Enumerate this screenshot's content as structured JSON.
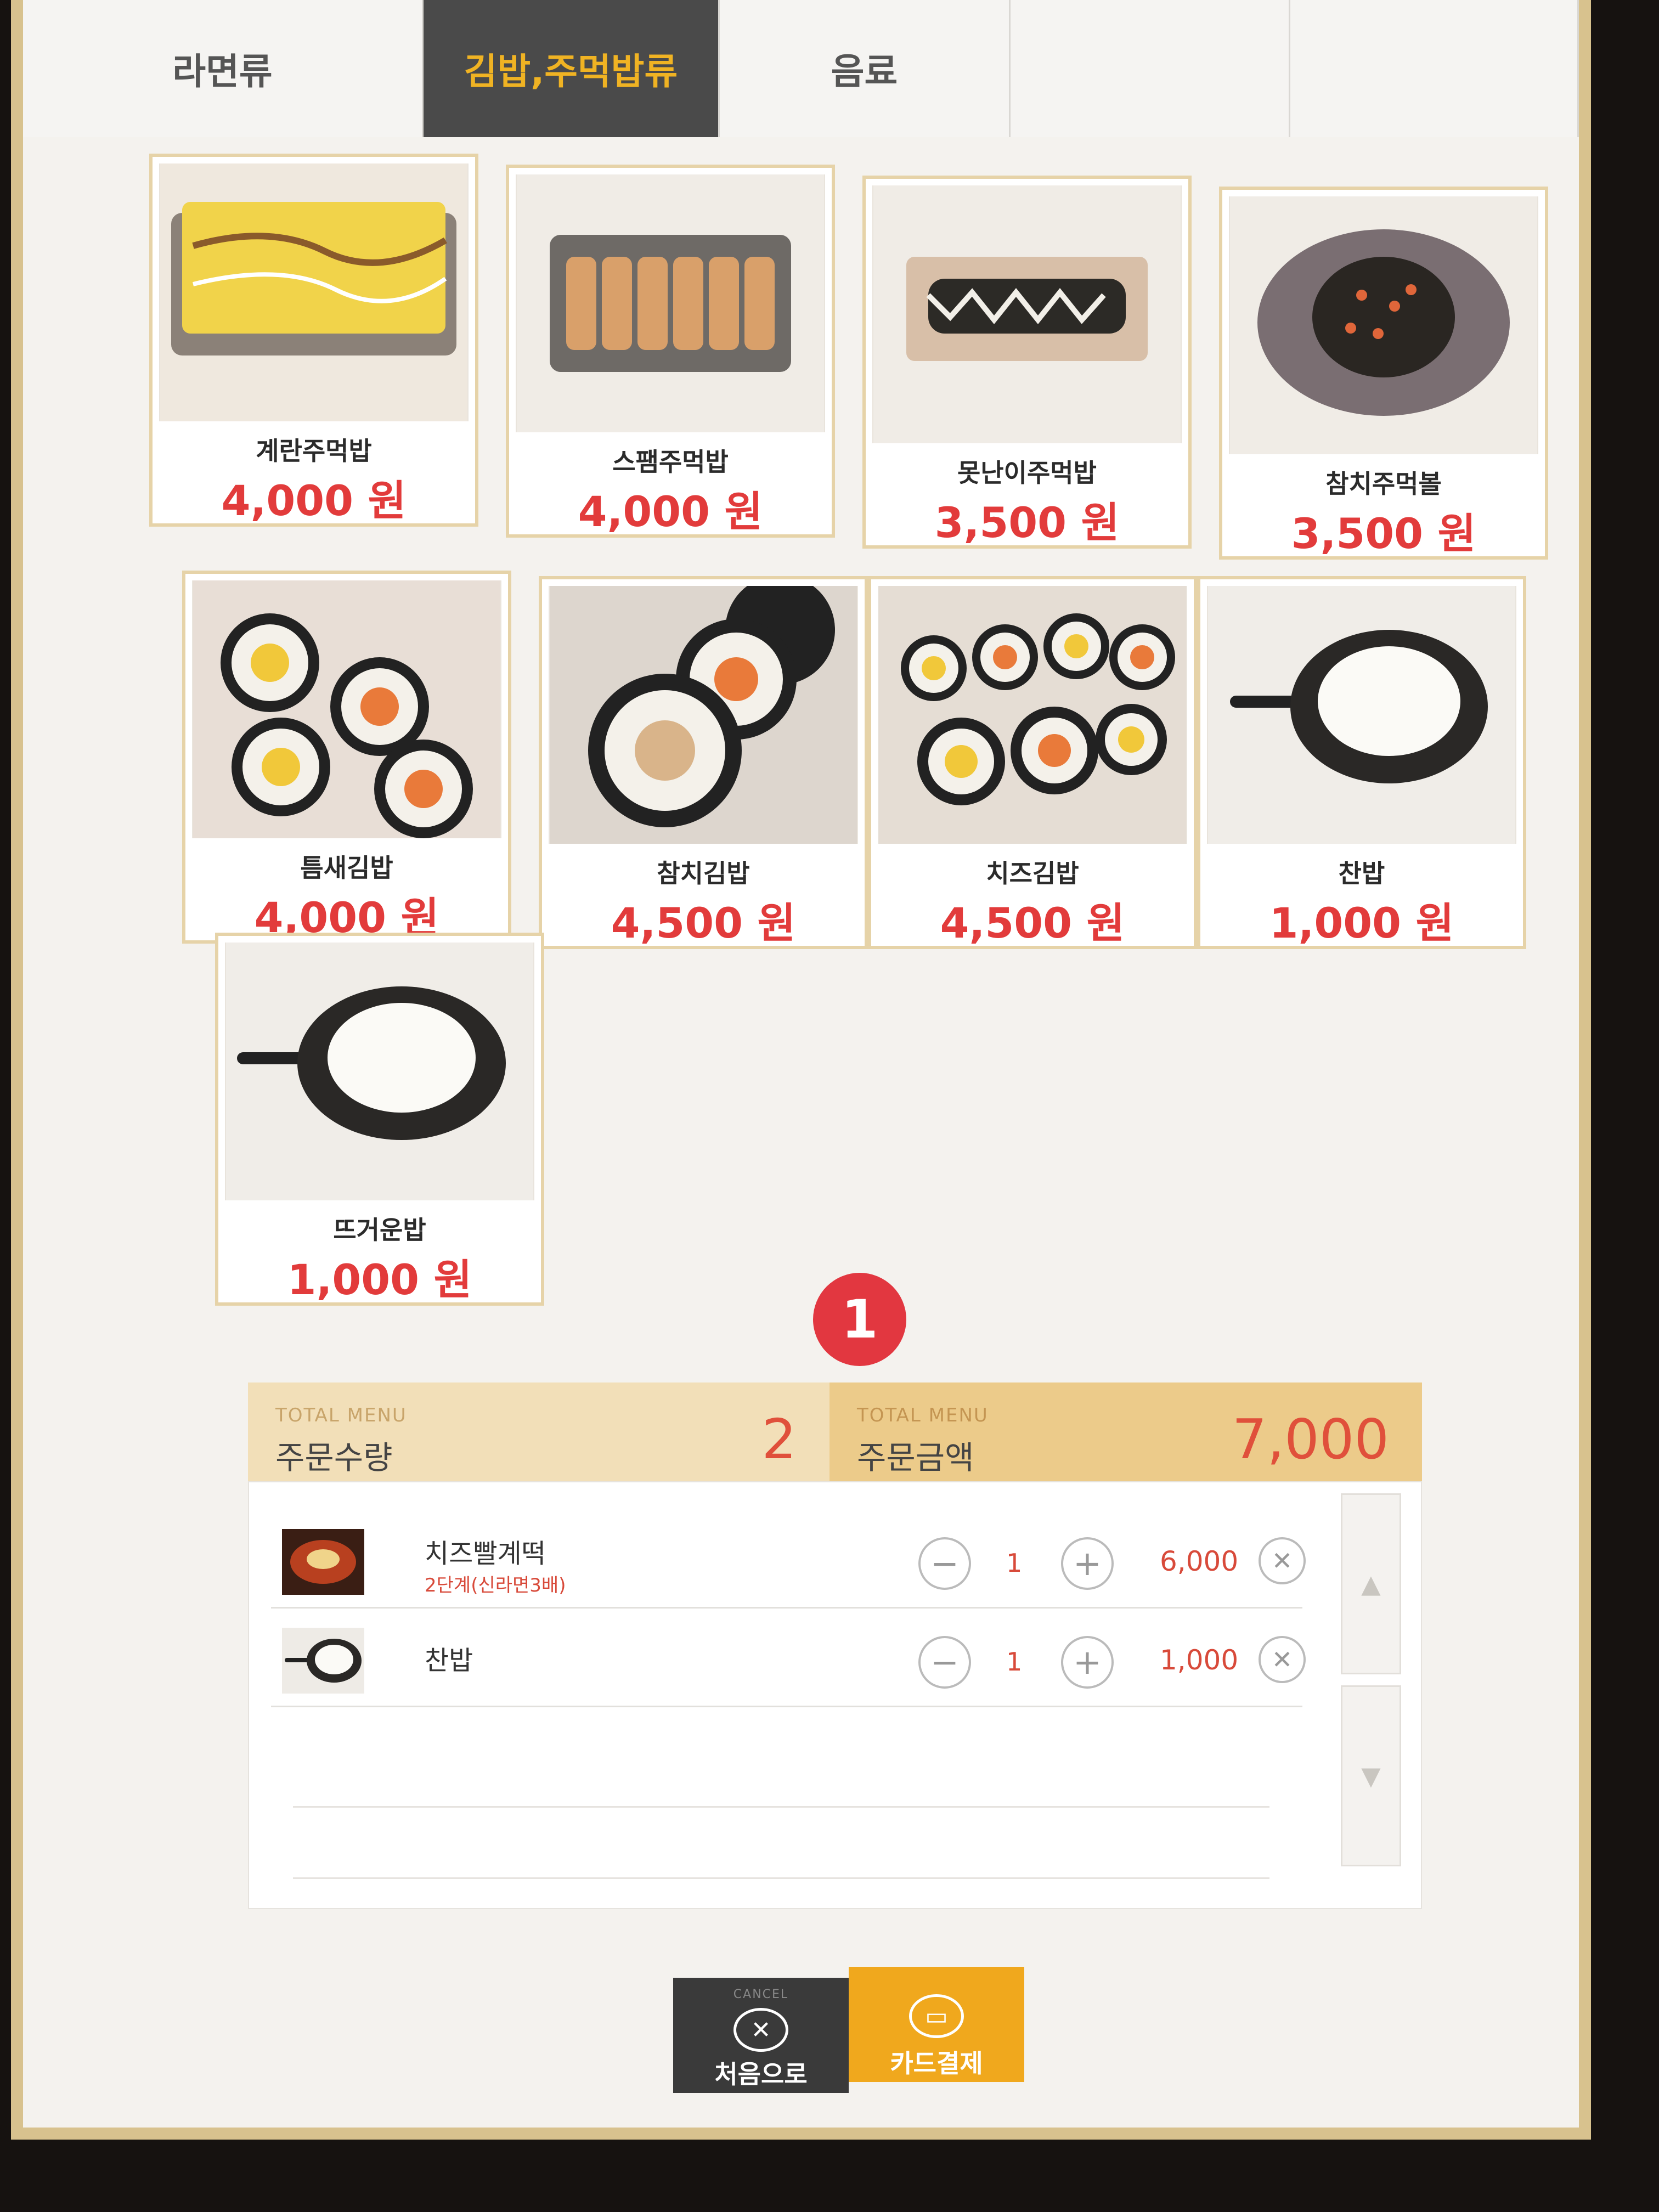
{
  "tabs": [
    {
      "label": "라면류",
      "active": false
    },
    {
      "label": "김밥,주먹밥류",
      "active": true
    },
    {
      "label": "음료",
      "active": false
    },
    {
      "label": "",
      "active": false
    },
    {
      "label": "",
      "active": false
    }
  ],
  "menu": [
    {
      "name": "계란주먹밥",
      "price": "4,000 원"
    },
    {
      "name": "스팸주먹밥",
      "price": "4,000 원"
    },
    {
      "name": "못난이주먹밥",
      "price": "3,500 원"
    },
    {
      "name": "참치주먹볼",
      "price": "3,500 원"
    },
    {
      "name": "틈새김밥",
      "price": "4,000 원"
    },
    {
      "name": "참치김밥",
      "price": "4,500 원"
    },
    {
      "name": "치즈김밥",
      "price": "4,500 원"
    },
    {
      "name": "찬밥",
      "price": "1,000 원"
    },
    {
      "name": "뜨거운밥",
      "price": "1,000 원"
    }
  ],
  "page_badge": "1",
  "totals": {
    "qty_small": "TOTAL MENU",
    "qty_label": "주문수량",
    "qty_value": "2",
    "amount_small": "TOTAL MENU",
    "amount_label": "주문금액",
    "amount_value": "7,000"
  },
  "order_items": [
    {
      "name": "치즈빨계떡",
      "option": "2단계(신라면3배)",
      "qty": "1",
      "price": "6,000"
    },
    {
      "name": "찬밥",
      "option": "",
      "qty": "1",
      "price": "1,000"
    }
  ],
  "buttons": {
    "cancel_small": "CANCEL",
    "cancel_label": "처음으로",
    "card_label": "카드결제"
  },
  "colors": {
    "accent": "#f0b323",
    "price": "#e23b3b",
    "card_button": "#f0a81d"
  }
}
